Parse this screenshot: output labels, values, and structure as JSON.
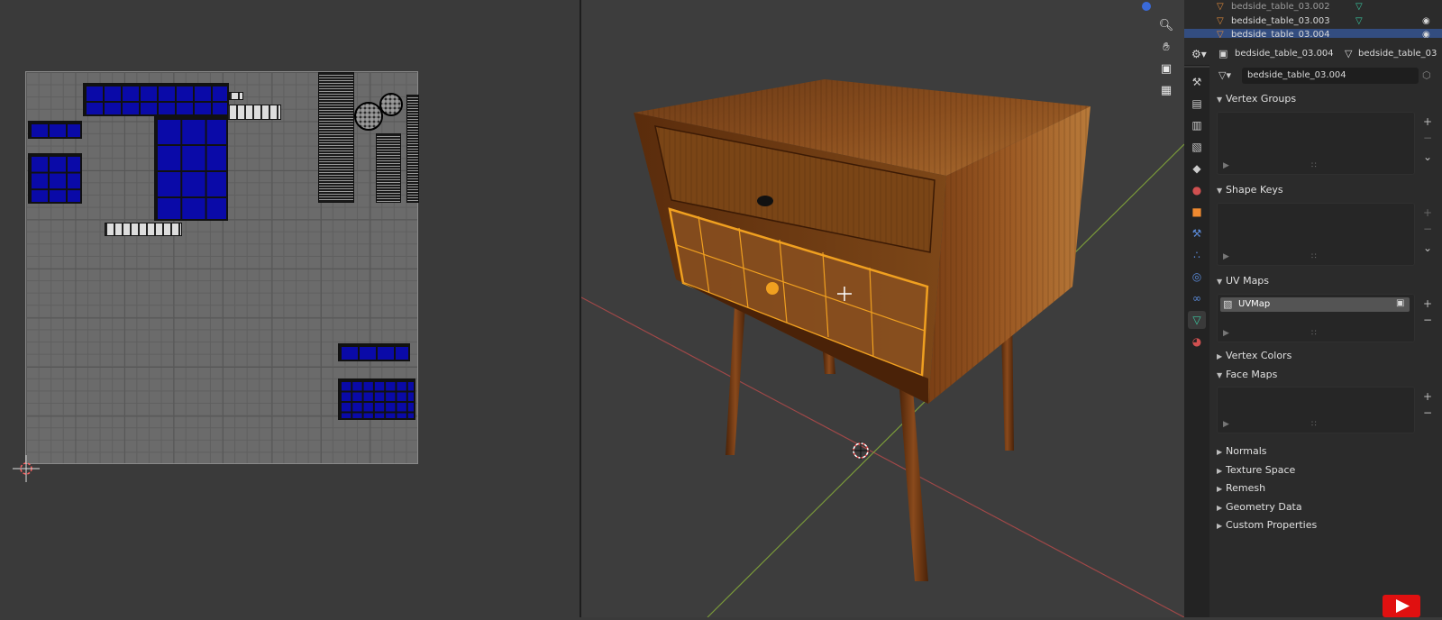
{
  "outliner": {
    "rows": [
      {
        "label": "bedside_table_03.002"
      },
      {
        "label": "bedside_table_03.003"
      },
      {
        "label": "bedside_table_03.004"
      }
    ]
  },
  "properties_header": {
    "object_name": "bedside_table_03.004",
    "mesh_name": "bedside_table_03"
  },
  "mesh_datablock": {
    "name": "bedside_table_03.004"
  },
  "panels": {
    "vertex_groups": "Vertex Groups",
    "shape_keys": "Shape Keys",
    "uv_maps": "UV Maps",
    "vertex_colors": "Vertex Colors",
    "face_maps": "Face Maps",
    "normals": "Normals",
    "texture_space": "Texture Space",
    "remesh": "Remesh",
    "geometry_data": "Geometry Data",
    "custom_properties": "Custom Properties"
  },
  "uv_maps": {
    "items": [
      {
        "name": "UVMap"
      }
    ]
  },
  "colors": {
    "selection_orange": "#f0a020",
    "uv_island_blue": "#0a0aa8",
    "active_blue": "#334d80"
  },
  "icons": {
    "viewport_tools": [
      "zoom-icon",
      "hand-icon",
      "camera-icon",
      "grid-icon"
    ]
  }
}
